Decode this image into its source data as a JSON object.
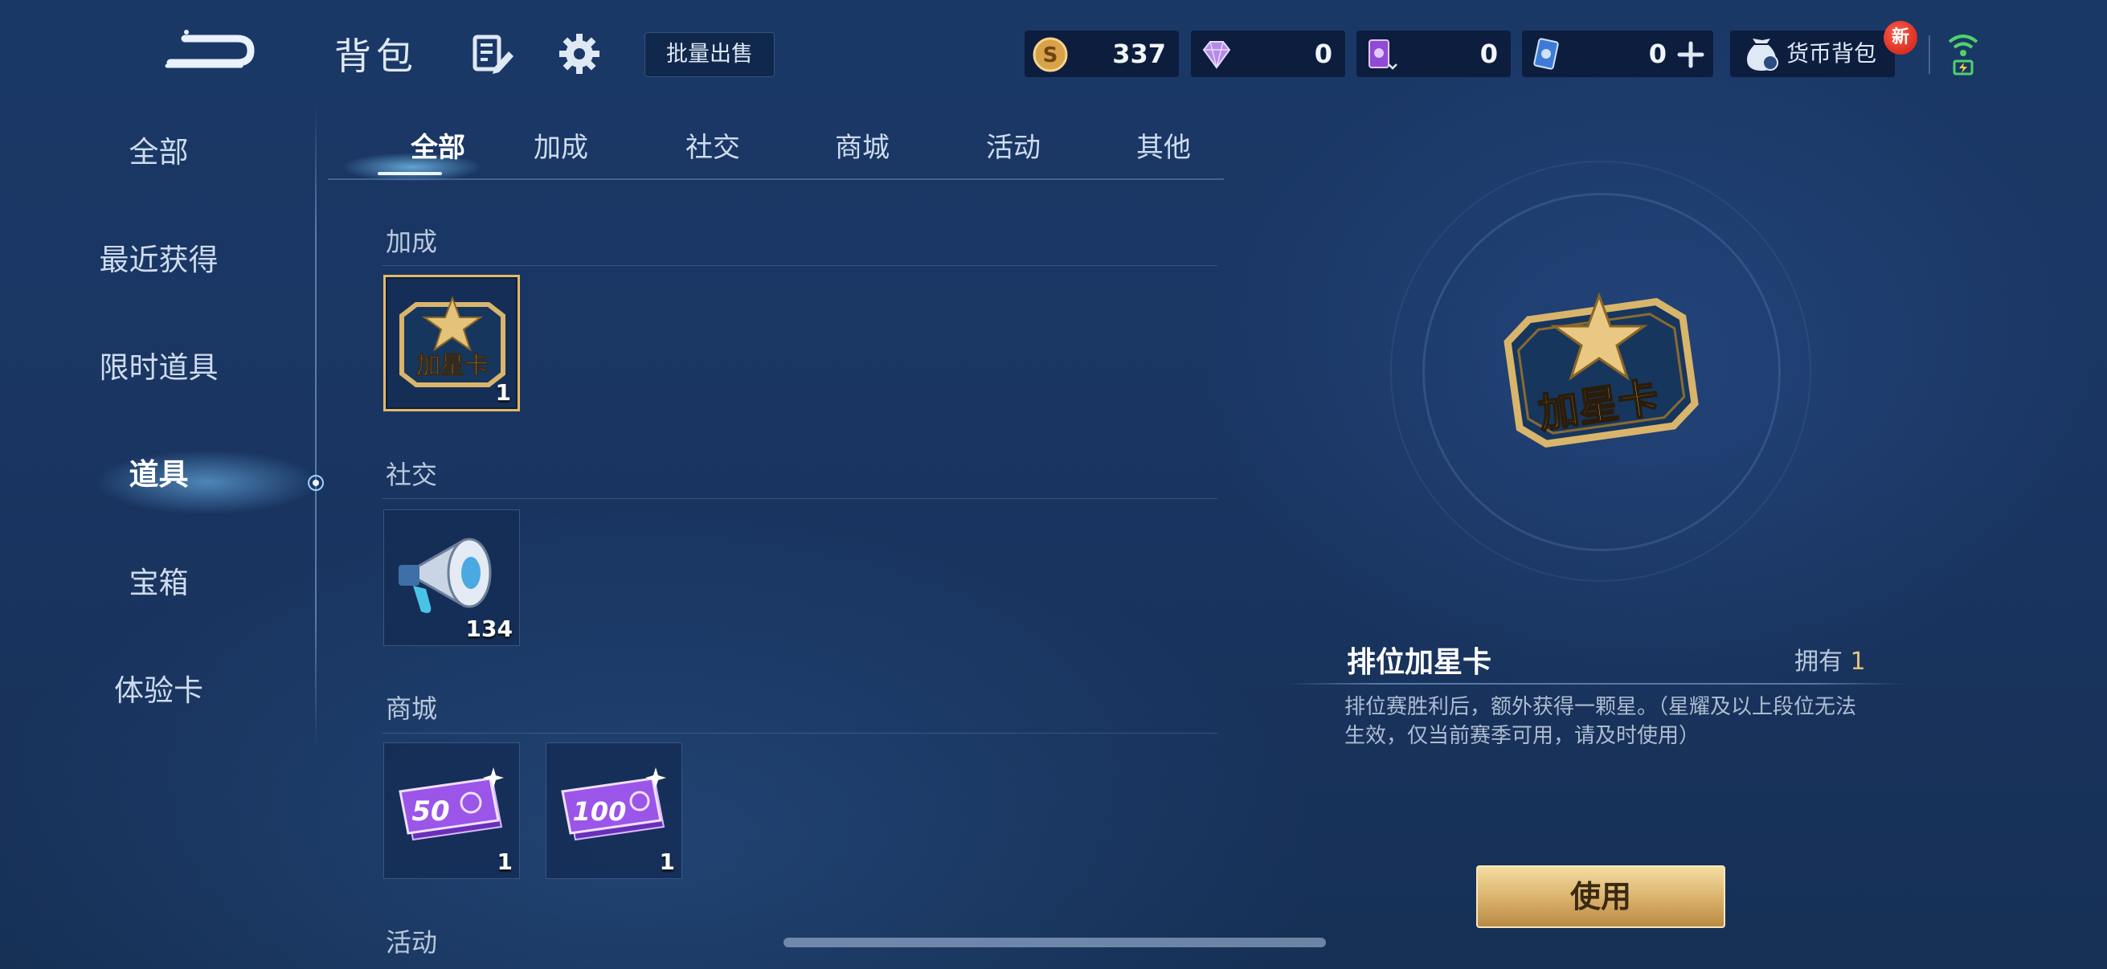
{
  "header": {
    "title": "背包",
    "bulk_sell_label": "批量出售",
    "currencies": [
      {
        "icon": "gold-coin-icon",
        "value": "337"
      },
      {
        "icon": "diamond-icon",
        "value": "0"
      },
      {
        "icon": "purple-card-icon",
        "value": "0"
      },
      {
        "icon": "blue-card-icon",
        "value": "0"
      }
    ],
    "wallet_label": "货币背包",
    "new_badge": "新"
  },
  "sidebar": {
    "items": [
      {
        "label": "全部",
        "active": false
      },
      {
        "label": "最近获得",
        "active": false
      },
      {
        "label": "限时道具",
        "active": false
      },
      {
        "label": "道具",
        "active": true
      },
      {
        "label": "宝箱",
        "active": false
      },
      {
        "label": "体验卡",
        "active": false
      }
    ]
  },
  "tabs": [
    {
      "label": "全部",
      "active": true
    },
    {
      "label": "加成",
      "active": false
    },
    {
      "label": "社交",
      "active": false
    },
    {
      "label": "商城",
      "active": false
    },
    {
      "label": "活动",
      "active": false
    },
    {
      "label": "其他",
      "active": false
    }
  ],
  "sections": [
    {
      "label": "加成",
      "items": [
        {
          "name": "排位加星卡",
          "icon_text": "加星卡",
          "count": "1",
          "selected": true
        }
      ]
    },
    {
      "label": "社交",
      "items": [
        {
          "name": "loudspeaker",
          "count": "134",
          "selected": false
        }
      ]
    },
    {
      "label": "商城",
      "items": [
        {
          "name": "coupon-50",
          "icon_text": "50",
          "count": "1",
          "selected": false
        },
        {
          "name": "coupon-100",
          "icon_text": "100",
          "count": "1",
          "selected": false
        }
      ]
    },
    {
      "label": "活动",
      "items": []
    }
  ],
  "detail": {
    "name": "排位加星卡",
    "owned_label": "拥有",
    "owned_count": "1",
    "icon_text": "加星卡",
    "description": "排位赛胜利后，额外获得一颗星。（星耀及以上段位无法生效，仅当前赛季可用，请及时使用）",
    "use_label": "使用"
  },
  "colors": {
    "accent_gold": "#e2b968",
    "button_gold": "#d9b06a",
    "background": "#1a3866"
  }
}
